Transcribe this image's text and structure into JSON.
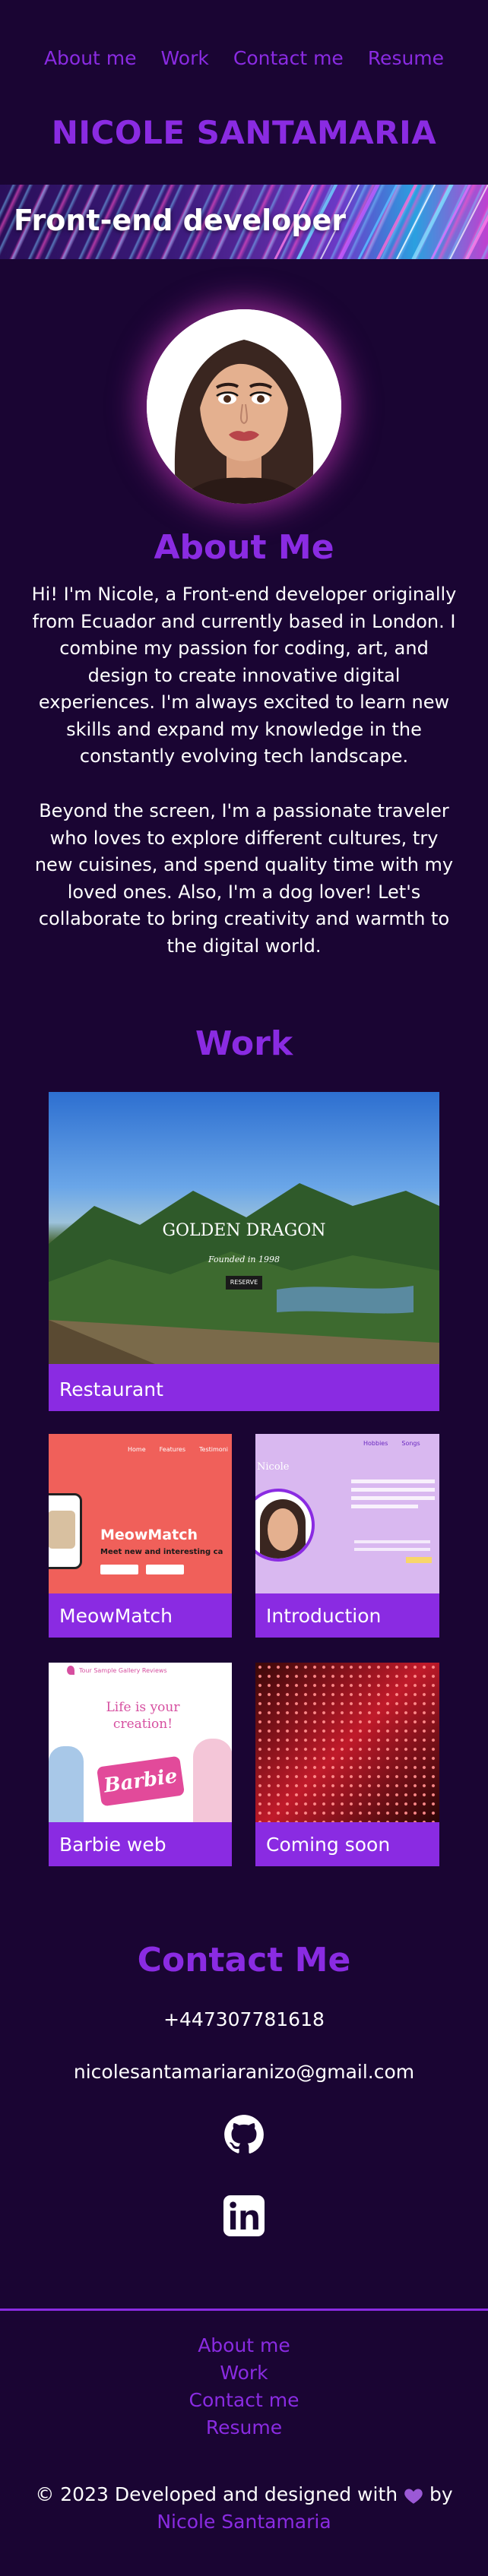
{
  "nav": {
    "items": [
      {
        "label": "About me"
      },
      {
        "label": "Work"
      },
      {
        "label": "Contact me"
      },
      {
        "label": "Resume"
      }
    ]
  },
  "brand": {
    "name": "NICOLE SANTAMARIA"
  },
  "hero": {
    "title": "Front-end developer"
  },
  "about": {
    "heading": "About Me",
    "paragraph1": "Hi! I'm Nicole, a Front-end developer originally from Ecuador and currently based in London. I combine my passion for coding, art, and design to create innovative digital experiences. I'm always excited to learn new skills and expand my knowledge in the constantly evolving tech landscape.",
    "paragraph2": "Beyond the screen, I'm a passionate traveler who loves to explore different cultures, try new cuisines, and spend quality time with my loved ones. Also, I'm a dog lover! Let's collaborate to bring creativity and warmth to the digital world."
  },
  "work": {
    "heading": "Work",
    "projects": [
      {
        "label": "Restaurant",
        "thumb_title": "GOLDEN DRAGON",
        "thumb_sub": "Founded in 1998",
        "thumb_btn": "RESERVE"
      },
      {
        "label": "MeowMatch",
        "thumb_title": "MeowMatch",
        "thumb_sub": "Meet new and interesting ca",
        "thumb_nav1": "Home",
        "thumb_nav2": "Features",
        "thumb_nav3": "Testimoni"
      },
      {
        "label": "Introduction",
        "thumb_title": "Nicole",
        "thumb_nav1": "Hobbies",
        "thumb_nav2": "Songs"
      },
      {
        "label": "Barbie web",
        "thumb_title": "Life is your creation!",
        "thumb_logo": "Barbie",
        "thumb_nav": "Tour  Sample  Gallery  Reviews"
      },
      {
        "label": "Coming soon"
      }
    ]
  },
  "contact": {
    "heading": "Contact Me",
    "phone": "+447307781618",
    "email": "nicolesantamariaranizo@gmail.com",
    "icons": [
      "github-icon",
      "linkedin-icon"
    ]
  },
  "footer": {
    "links": [
      {
        "label": "About me"
      },
      {
        "label": "Work"
      },
      {
        "label": "Contact me"
      },
      {
        "label": "Resume"
      }
    ],
    "copyright_prefix": "© 2023 Developed and designed with",
    "copyright_suffix": "by",
    "credit": "Nicole Santamaria"
  },
  "colors": {
    "background": "#1a0533",
    "accent": "#8a2be2",
    "text": "#ffffff"
  }
}
